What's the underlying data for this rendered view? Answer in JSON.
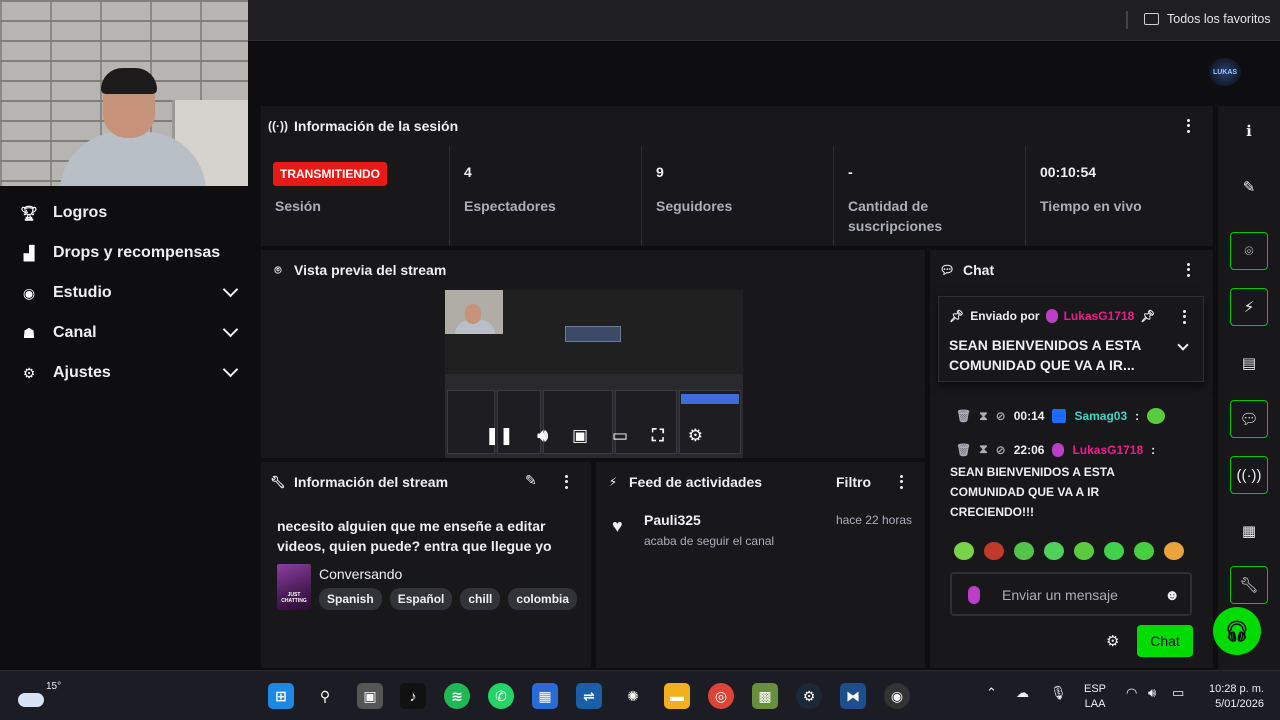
{
  "browser": {
    "bookmarks_all": "Todos los favoritos"
  },
  "sidebar": {
    "items": [
      {
        "label": "Logros",
        "icon": "trophy-icon",
        "has_chevron": false
      },
      {
        "label": "Drops y recompensas",
        "icon": "gift-icon",
        "has_chevron": false
      },
      {
        "label": "Estudio",
        "icon": "studio-icon",
        "has_chevron": true
      },
      {
        "label": "Canal",
        "icon": "channel-icon",
        "has_chevron": true
      },
      {
        "label": "Ajustes",
        "icon": "gear-icon",
        "has_chevron": true
      }
    ]
  },
  "header": {
    "logo_text": "LUKAS"
  },
  "session": {
    "title": "Información de la sesión",
    "status_badge": "TRANSMITIENDO",
    "status_label": "Sesión",
    "viewers_value": "4",
    "viewers_label": "Espectadores",
    "followers_value": "9",
    "followers_label": "Seguidores",
    "subs_value": "-",
    "subs_label": "Cantidad de suscripciones",
    "live_value": "00:10:54",
    "live_label": "Tiempo en vivo"
  },
  "preview": {
    "title": "Vista previa del stream"
  },
  "stream_info": {
    "title": "Información del stream",
    "stream_title": "necesito alguien que me enseñe a editar videos, quien puede? entra que llegue yo",
    "category": "Conversando",
    "category_art_text": "JUST CHATTING",
    "tags": [
      "Spanish",
      "Español",
      "chill",
      "colombia"
    ]
  },
  "feed": {
    "title": "Feed de actividades",
    "filter_label": "Filtro",
    "items": [
      {
        "user": "Pauli325",
        "time": "hace 22 horas",
        "desc": "acaba de seguir el canal"
      }
    ]
  },
  "chat": {
    "title": "Chat",
    "pinned_by_label": "Enviado por",
    "pinned_user": "LukasG1718",
    "pinned_message": "SEAN BIENVENIDOS A ESTA COMUNIDAD QUE VA A IR...",
    "messages": [
      {
        "time": "00:14",
        "user": "Samag03",
        "sep": ":"
      },
      {
        "time": "00:14",
        "user": "Samag03",
        "sep": ":"
      },
      {
        "time": "22:06",
        "user": "LukasG1718",
        "sep": ":"
      }
    ],
    "message_text": "SEAN BIENVENIDOS A ESTA COMUNIDAD QUE VA A IR CRECIENDO!!!",
    "input_placeholder": "Enviar un mensaje",
    "send_label": "Chat",
    "colors": {
      "streamer": "#e91e8c",
      "viewer": "#3fd2c7",
      "accent": "#00db00"
    }
  },
  "taskbar": {
    "weather_temp": "15°",
    "lang_line1": "ESP",
    "lang_line2": "LAA",
    "time": "10:28 p. m.",
    "date": "5/01/2026"
  }
}
